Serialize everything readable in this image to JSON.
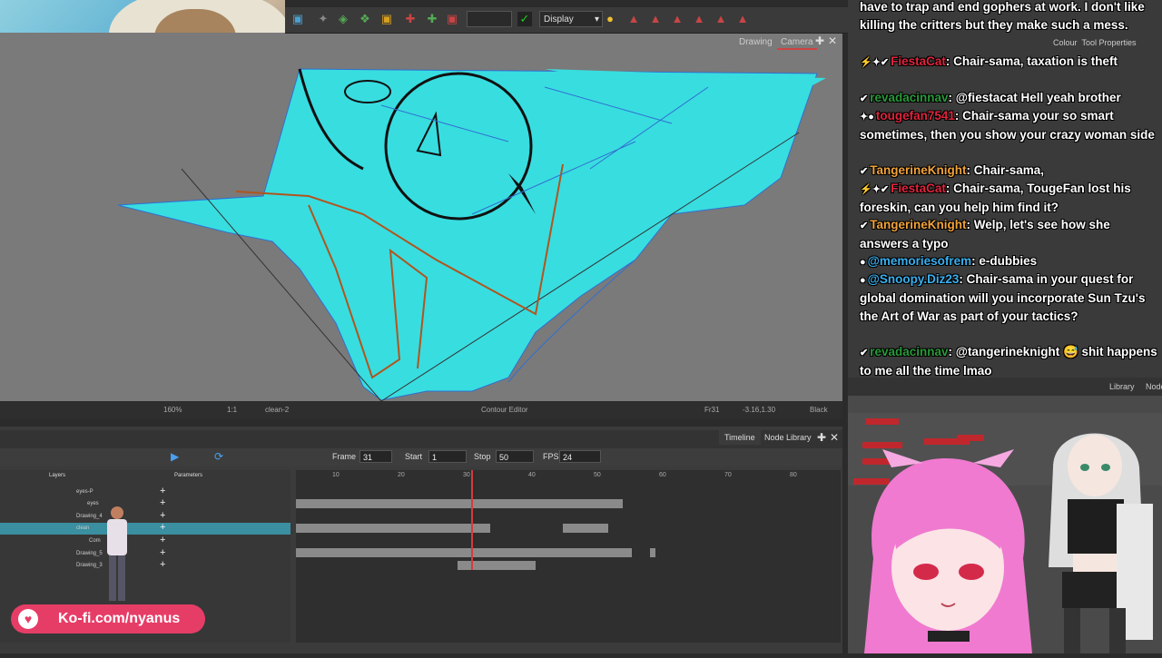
{
  "view_tabs": {
    "drawing": "Drawing",
    "camera": "Camera"
  },
  "toolbar": {
    "display_label": "Display"
  },
  "canvas_status": {
    "zoom": "160%",
    "size": "1:1",
    "layer": "clean-2",
    "editor": "Contour Editor",
    "frame": "Fr31",
    "coords": "-3.16,1.30",
    "color": "Black"
  },
  "timeline": {
    "tab_timeline": "Timeline",
    "tab_node_library": "Node Library",
    "frame_label": "Frame",
    "frame_value": "31",
    "start_label": "Start",
    "start_value": "1",
    "stop_label": "Stop",
    "stop_value": "50",
    "fps_label": "FPS",
    "fps_value": "24",
    "layers_header": "Layers",
    "params_header": "Parameters",
    "ruler": [
      "10",
      "20",
      "30",
      "40",
      "50",
      "60",
      "70",
      "80"
    ],
    "layers": [
      "eyes-P",
      "eyes",
      "Drawing_4",
      "clean",
      "Com",
      "Drawing_5",
      "Drawing_3"
    ]
  },
  "kofi": {
    "text": "Ko-fi.com/nyanus"
  },
  "right_panel": {
    "colour_tab": "Colour",
    "tool_props_tab": "Tool Properties",
    "library_tab": "Library",
    "node_tab": "Node"
  },
  "chat": [
    {
      "user": "",
      "text": "have to trap and end gophers at work. I don't like killing the critters but they make such a mess.",
      "color": "#ffffff"
    },
    {
      "user": "FiestaCat",
      "text": ": Chair-sama, taxation is theft",
      "color": "#e0243c",
      "badges": "⚡✦✔"
    },
    {
      "user": "revadacinnav",
      "text": ": @fiestacat Hell yeah brother",
      "color": "#2a9a3a",
      "badges": "✔"
    },
    {
      "user": "tougefan7541",
      "text": ": Chair-sama your so smart sometimes, then you show your crazy woman side",
      "color": "#e0243c",
      "badges": "✦●"
    },
    {
      "user": "TangerineKnight",
      "text": ": Chair-sama,",
      "color": "#f2a33a",
      "badges": "✔"
    },
    {
      "user": "FiestaCat",
      "text": ": Chair-sama, TougeFan lost his foreskin, can you help him find it?",
      "color": "#e0243c",
      "badges": "⚡✦✔"
    },
    {
      "user": "TangerineKnight",
      "text": ": Welp, let's see how she answers a typo",
      "color": "#f2a33a",
      "badges": "✔"
    },
    {
      "user": "@memoriesofrem",
      "text": ": e-dubbies",
      "color": "#3ab0f0",
      "badges": "●"
    },
    {
      "user": "@Snoopy.Diz23",
      "text": ": Chair-sama in your quest for global domination will you incorporate Sun Tzu's the Art of War as part of your tactics?",
      "color": "#3ab0f0",
      "badges": "●"
    },
    {
      "user": "revadacinnav",
      "text": ": @tangerineknight 😅 shit happens to me all the time lmao",
      "color": "#2a9a3a",
      "badges": "✔"
    }
  ]
}
